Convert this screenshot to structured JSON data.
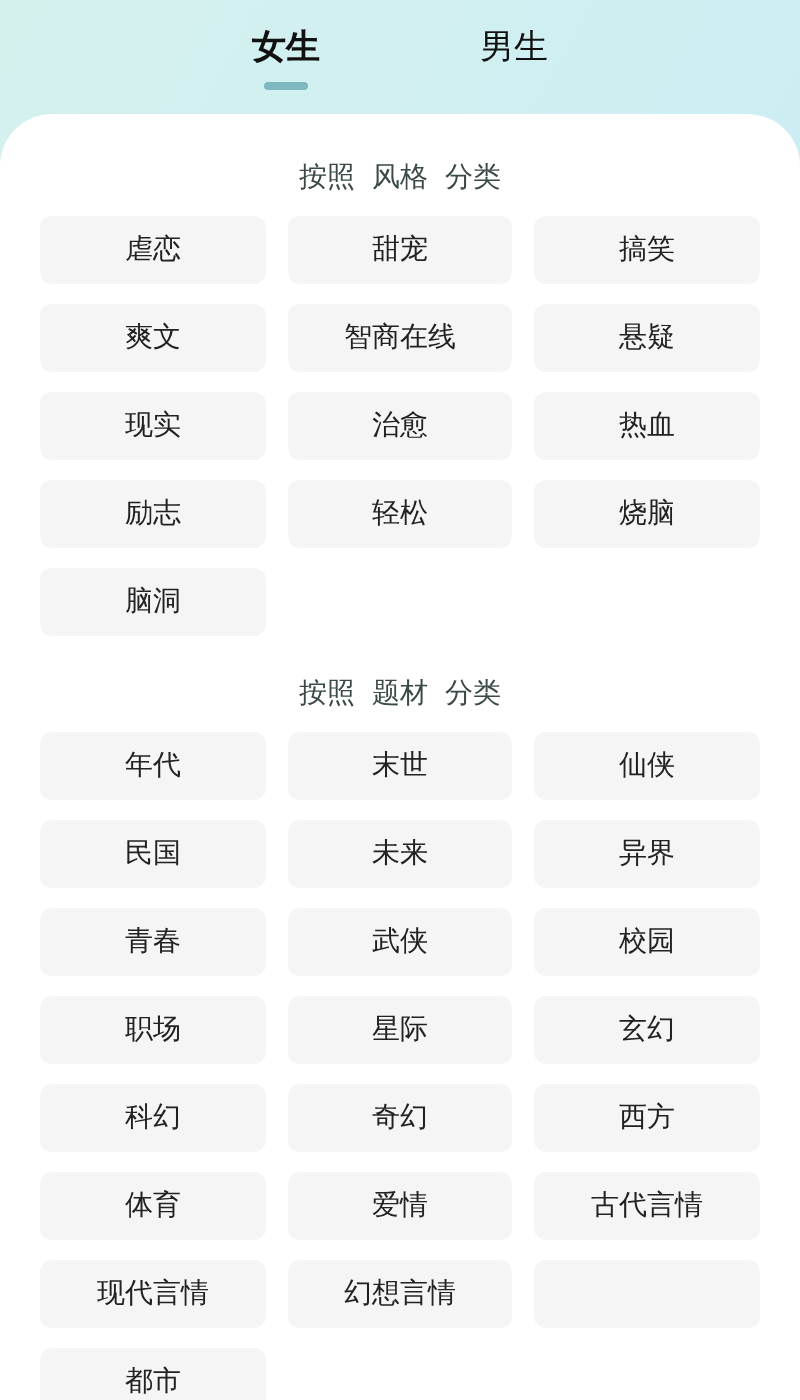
{
  "tabs": [
    {
      "label": "女生",
      "selected": true
    },
    {
      "label": "男生",
      "selected": false
    }
  ],
  "sections": [
    {
      "title": "按照 风格 分类",
      "items": [
        "虐恋",
        "甜宠",
        "搞笑",
        "爽文",
        "智商在线",
        "悬疑",
        "现实",
        "治愈",
        "热血",
        "励志",
        "轻松",
        "烧脑",
        "脑洞"
      ]
    },
    {
      "title": "按照 题材 分类",
      "items": [
        "年代",
        "末世",
        "仙侠",
        "民国",
        "未来",
        "异界",
        "青春",
        "武侠",
        "校园",
        "职场",
        "星际",
        "玄幻",
        "科幻",
        "奇幻",
        "西方",
        "体育",
        "爱情",
        "古代言情",
        "现代言情",
        "幻想言情",
        {
          "kind": "blank"
        },
        "都市"
      ]
    }
  ]
}
